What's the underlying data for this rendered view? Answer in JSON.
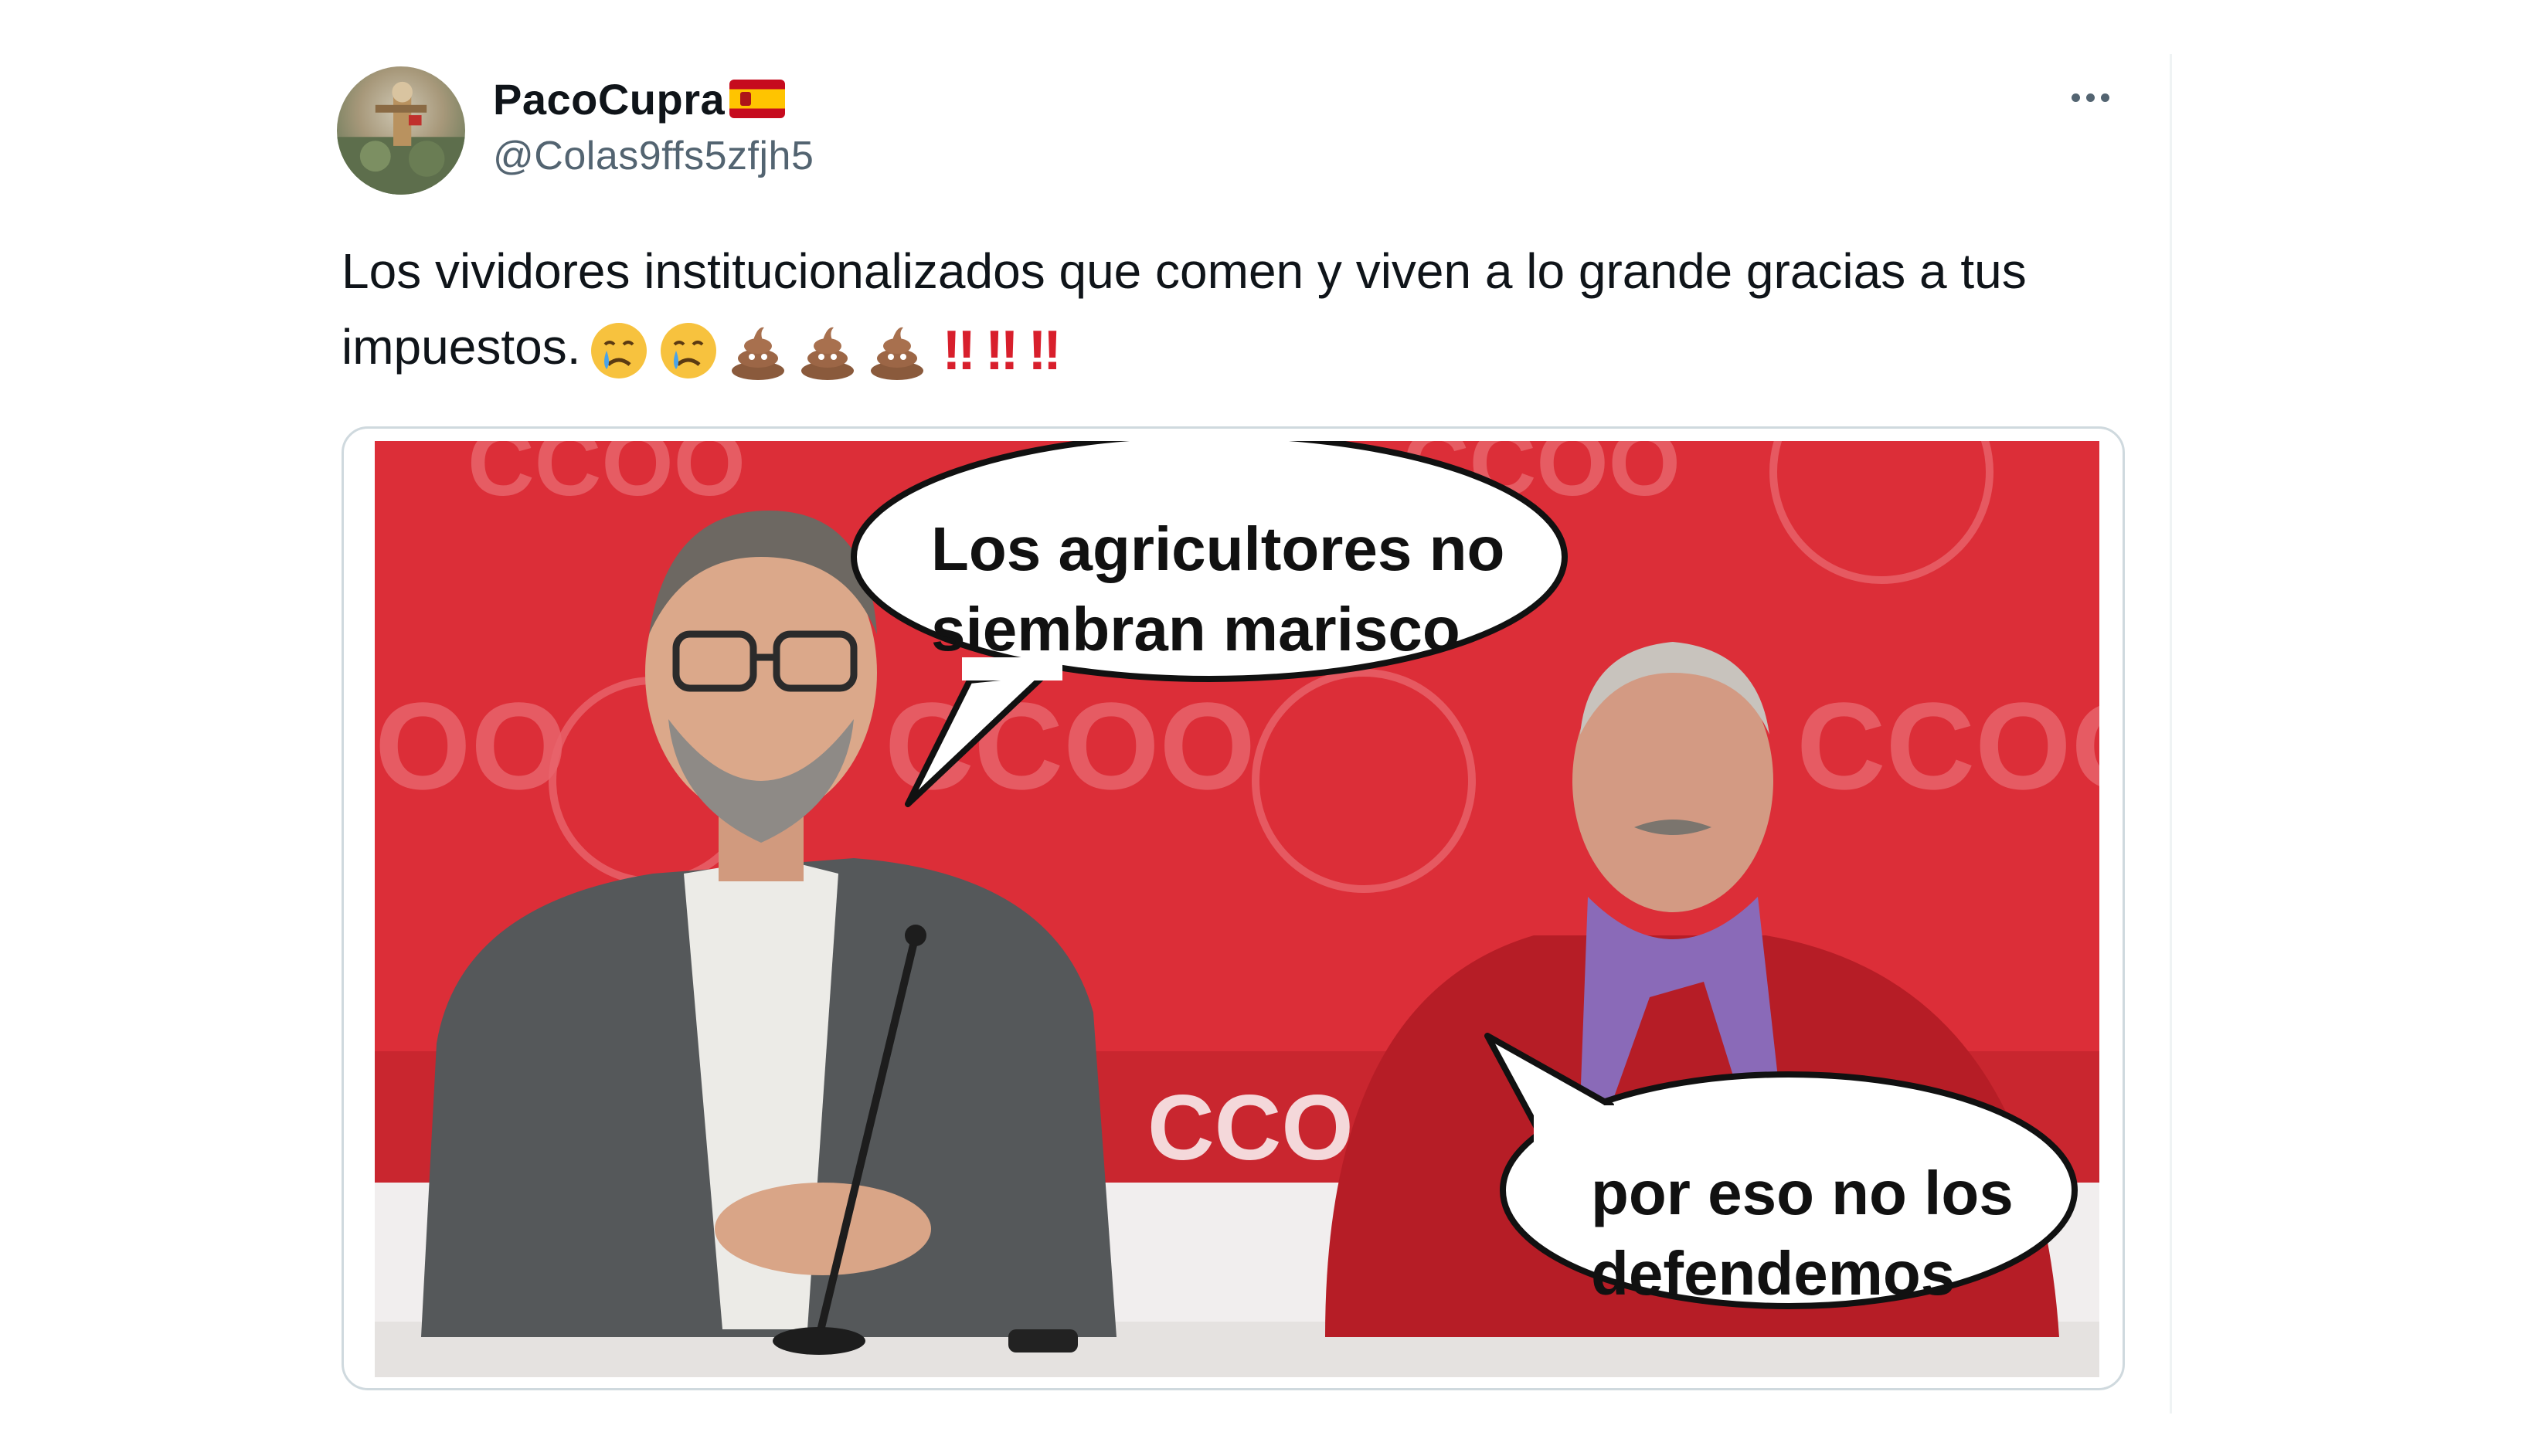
{
  "tweet": {
    "display_name": "PacoCupra",
    "handle": "@Colas9ffs5zfjh5",
    "text": "Los vividores institucionalizados que comen y viven a lo grande gracias a tus impuestos.",
    "emojis": [
      "crying-face",
      "crying-face",
      "pile-of-poo",
      "pile-of-poo",
      "pile-of-poo"
    ],
    "exclamations": [
      "‼",
      "‼",
      "‼"
    ]
  },
  "meme": {
    "bubble_1": "Los agricultores no siembran marisco",
    "bubble_2": "por eso no los defendemos",
    "backdrop_text": "CCOO"
  },
  "colors": {
    "text_primary": "#0f1419",
    "text_secondary": "#536471",
    "border": "#cfd9de",
    "backdrop_red": "#dc2e38"
  }
}
